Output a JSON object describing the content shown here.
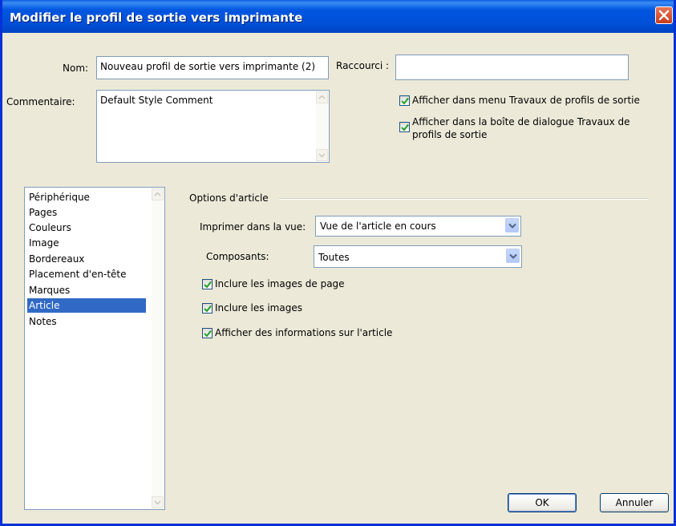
{
  "window": {
    "title": "Modifier le profil de sortie vers imprimante"
  },
  "form": {
    "name_label": "Nom:",
    "name_value": "Nouveau profil de sortie vers imprimante (2)",
    "shortcut_label": "Raccourci :",
    "shortcut_value": "",
    "comment_label": "Commentaire:",
    "comment_value": "Default Style Comment",
    "show_in_menu_label": "Afficher dans menu Travaux de profils de sortie",
    "show_in_menu_checked": true,
    "show_in_dialog_label_line1": "Afficher dans la boîte de dialogue Travaux de",
    "show_in_dialog_label_line2": "profils de sortie",
    "show_in_dialog_checked": true
  },
  "sidebar": {
    "items": [
      {
        "label": "Périphérique",
        "selected": false
      },
      {
        "label": "Pages",
        "selected": false
      },
      {
        "label": "Couleurs",
        "selected": false
      },
      {
        "label": "Image",
        "selected": false
      },
      {
        "label": "Bordereaux",
        "selected": false
      },
      {
        "label": "Placement d'en-tête",
        "selected": false
      },
      {
        "label": "Marques",
        "selected": false
      },
      {
        "label": "Article",
        "selected": true
      },
      {
        "label": "Notes",
        "selected": false
      }
    ]
  },
  "article_options": {
    "group_title": "Options d'article",
    "print_view_label": "Imprimer dans la vue:",
    "print_view_value": "Vue de l'article en cours",
    "components_label": "Composants:",
    "components_value": "Toutes",
    "include_page_images_label": "Inclure les images de page",
    "include_page_images_checked": true,
    "include_images_label": "Inclure les images",
    "include_images_checked": true,
    "show_article_info_label": "Afficher des informations sur l'article",
    "show_article_info_checked": true
  },
  "buttons": {
    "ok_label": "OK",
    "cancel_label": "Annuler"
  },
  "colors": {
    "titlebar": "#0054e3",
    "selection": "#316ac5",
    "dialog_bg": "#ece9d8",
    "check": "#21a121",
    "close": "#e04a20"
  }
}
